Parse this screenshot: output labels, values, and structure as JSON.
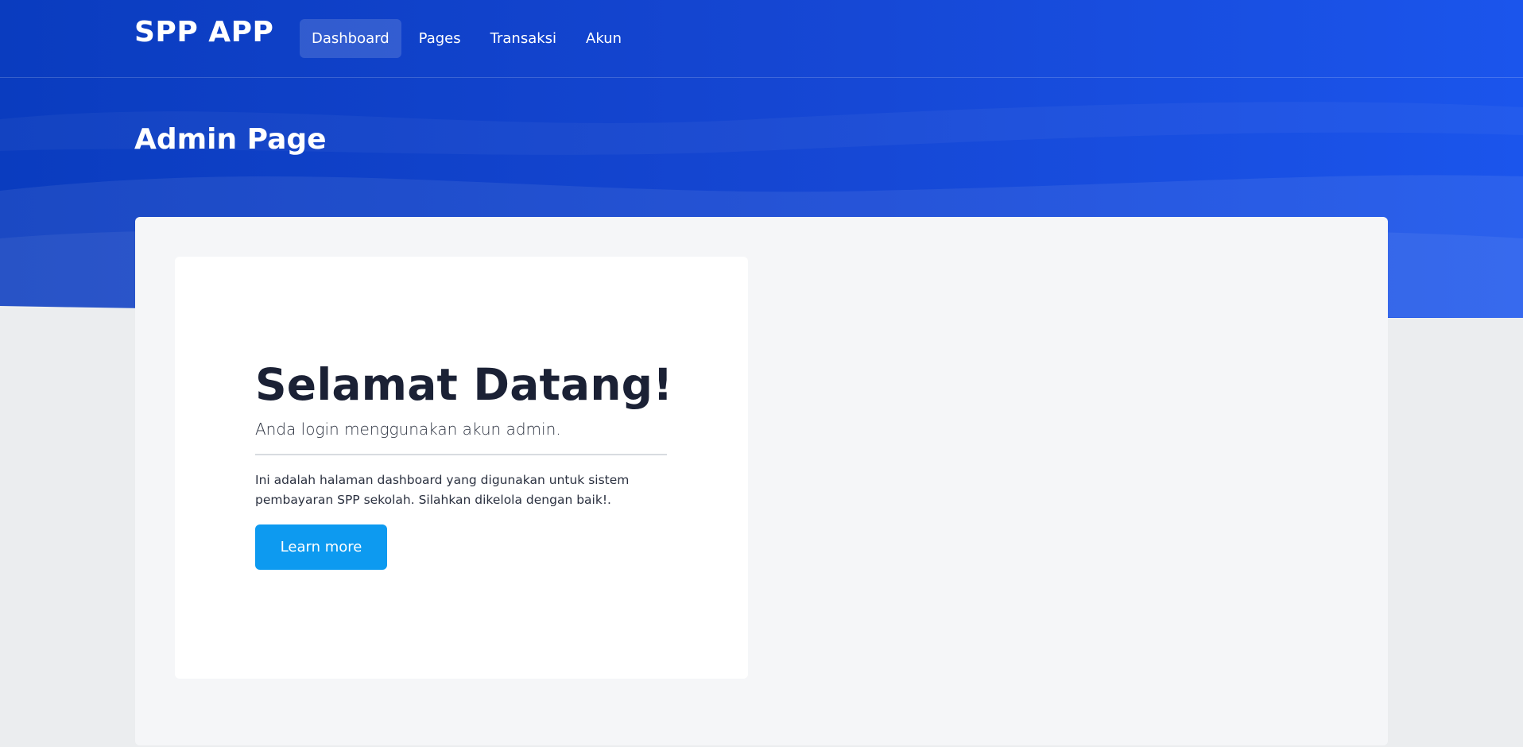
{
  "navbar": {
    "brand": "SPP APP",
    "items": [
      {
        "label": "Dashboard",
        "active": true
      },
      {
        "label": "Pages",
        "active": false
      },
      {
        "label": "Transaksi",
        "active": false
      },
      {
        "label": "Akun",
        "active": false
      }
    ]
  },
  "header": {
    "title": "Admin Page"
  },
  "welcome_card": {
    "heading": "Selamat Datang!",
    "lead": "Anda login menggunakan akun admin.",
    "body": "Ini adalah halaman dashboard yang digunakan untuk sistem pembayaran SPP sekolah. Silahkan dikelola dengan baik!.",
    "button_label": "Learn more"
  },
  "colors": {
    "hero_blue": "#1848d4",
    "button_blue": "#0d9af0",
    "page_background": "#ebedef",
    "panel_background": "#f5f6f8"
  }
}
